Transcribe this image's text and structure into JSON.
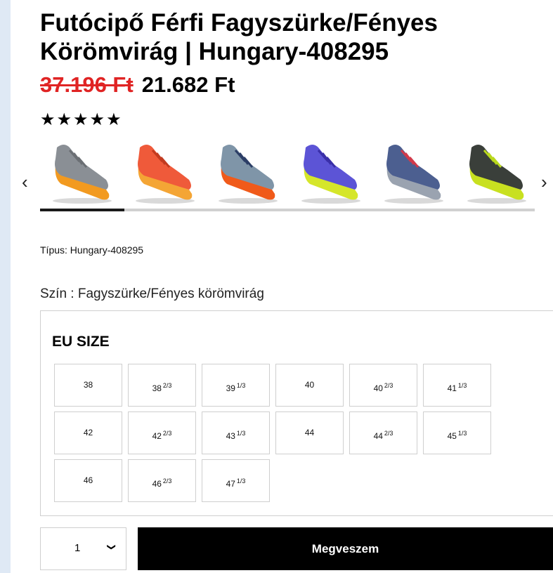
{
  "product": {
    "title": "Futócipő Férfi Fagyszürke/Fényes Körömvirág | Hungary-408295",
    "old_price": "37.196 Ft",
    "new_price": "21.682 Ft",
    "rating_stars": "★★★★★",
    "rating_value": 5,
    "type_line": "Típus: Hungary-408295",
    "color_line": "Szín : Fagyszürke/Fényes körömvirág"
  },
  "carousel": {
    "prev_icon": "chevron-left-icon",
    "next_icon": "chevron-right-icon",
    "prev_glyph": "‹",
    "next_glyph": "›",
    "progress": 0.17,
    "thumbs": [
      {
        "upper": "#8a8f95",
        "sole": "#f29a20",
        "lace": "#6b6f74"
      },
      {
        "upper": "#ef5a3a",
        "sole": "#f4a535",
        "lace": "#c23b20"
      },
      {
        "upper": "#7f95a8",
        "sole": "#f05a1a",
        "lace": "#2c3e66"
      },
      {
        "upper": "#5c54d6",
        "sole": "#d5e62a",
        "lace": "#3a2fa8"
      },
      {
        "upper": "#4c5f90",
        "sole": "#9aa3b0",
        "lace": "#d23a4a"
      },
      {
        "upper": "#3a3f3a",
        "sole": "#c8e020",
        "lace": "#b9d81c"
      }
    ]
  },
  "sizes": {
    "heading": "EU SIZE",
    "items": [
      {
        "whole": "38",
        "frac": ""
      },
      {
        "whole": "38",
        "frac": "2/3"
      },
      {
        "whole": "39",
        "frac": "1/3"
      },
      {
        "whole": "40",
        "frac": ""
      },
      {
        "whole": "40",
        "frac": "2/3"
      },
      {
        "whole": "41",
        "frac": "1/3"
      },
      {
        "whole": "42",
        "frac": ""
      },
      {
        "whole": "42",
        "frac": "2/3"
      },
      {
        "whole": "43",
        "frac": "1/3"
      },
      {
        "whole": "44",
        "frac": ""
      },
      {
        "whole": "44",
        "frac": "2/3"
      },
      {
        "whole": "45",
        "frac": "1/3"
      },
      {
        "whole": "46",
        "frac": ""
      },
      {
        "whole": "46",
        "frac": "2/3"
      },
      {
        "whole": "47",
        "frac": "1/3"
      }
    ]
  },
  "purchase": {
    "quantity": "1",
    "chevron_glyph": "⌄",
    "buy_label": "Megveszem"
  }
}
